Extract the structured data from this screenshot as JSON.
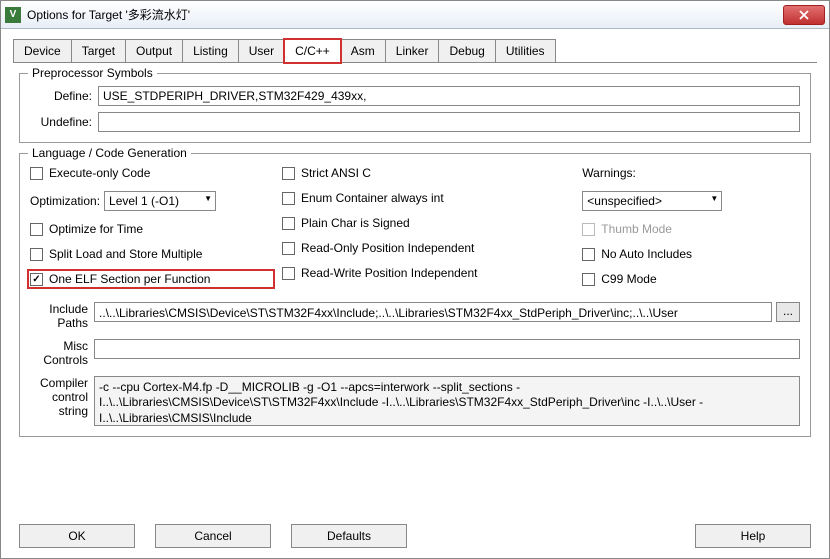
{
  "window": {
    "title": "Options for Target '多彩流水灯'"
  },
  "tabs": [
    "Device",
    "Target",
    "Output",
    "Listing",
    "User",
    "C/C++",
    "Asm",
    "Linker",
    "Debug",
    "Utilities"
  ],
  "active_tab": "C/C++",
  "preproc": {
    "legend": "Preprocessor Symbols",
    "define_label": "Define:",
    "define_value": "USE_STDPERIPH_DRIVER,STM32F429_439xx,",
    "undefine_label": "Undefine:",
    "undefine_value": ""
  },
  "lang": {
    "legend": "Language / Code Generation",
    "execute_only": "Execute-only Code",
    "optimization_label": "Optimization:",
    "optimization_value": "Level 1 (-O1)",
    "optimize_time": "Optimize for Time",
    "split_load": "Split Load and Store Multiple",
    "one_elf": "One ELF Section per Function",
    "strict_ansi": "Strict ANSI C",
    "enum_container": "Enum Container always int",
    "plain_char": "Plain Char is Signed",
    "readonly_pi": "Read-Only Position Independent",
    "readwrite_pi": "Read-Write Position Independent",
    "warnings_label": "Warnings:",
    "warnings_value": "<unspecified>",
    "thumb_mode": "Thumb Mode",
    "no_auto_inc": "No Auto Includes",
    "c99_mode": "C99 Mode"
  },
  "paths": {
    "include_label": "Include Paths",
    "include_value": "..\\..\\Libraries\\CMSIS\\Device\\ST\\STM32F4xx\\Include;..\\..\\Libraries\\STM32F4xx_StdPeriph_Driver\\inc;..\\..\\User",
    "misc_label": "Misc Controls",
    "misc_value": "",
    "compiler_label": "Compiler control string",
    "compiler_value": "-c --cpu Cortex-M4.fp -D__MICROLIB -g -O1 --apcs=interwork --split_sections -I..\\..\\Libraries\\CMSIS\\Device\\ST\\STM32F4xx\\Include -I..\\..\\Libraries\\STM32F4xx_StdPeriph_Driver\\inc -I..\\..\\User -I..\\..\\Libraries\\CMSIS\\Include",
    "browse": "..."
  },
  "buttons": {
    "ok": "OK",
    "cancel": "Cancel",
    "defaults": "Defaults",
    "help": "Help"
  }
}
